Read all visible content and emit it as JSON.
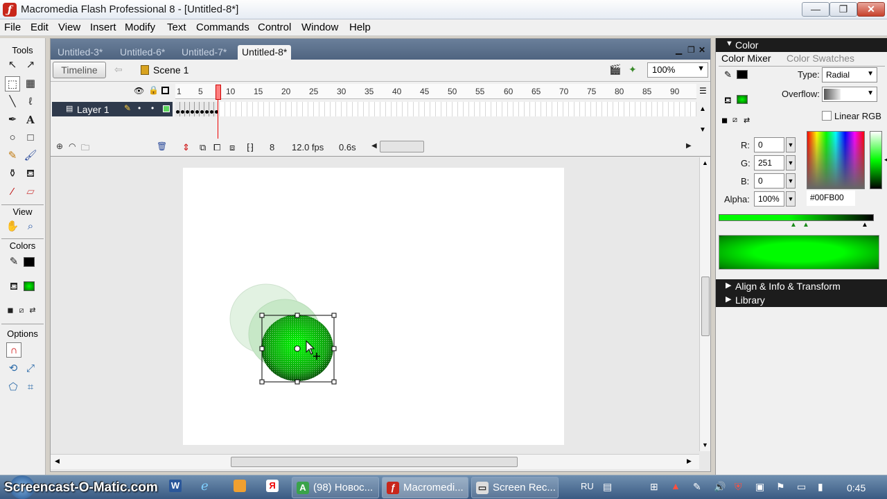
{
  "window": {
    "title": "Macromedia Flash Professional 8 - [Untitled-8*]",
    "app_icon": "flash-app-icon",
    "minimize": "—",
    "restore": "❐",
    "close": "✕"
  },
  "menu": [
    "File",
    "Edit",
    "View",
    "Insert",
    "Modify",
    "Text",
    "Commands",
    "Control",
    "Window",
    "Help"
  ],
  "tools": {
    "header": "Tools",
    "view_header": "View",
    "colors_header": "Colors",
    "options_header": "Options"
  },
  "document": {
    "tabs": [
      "Untitled-3*",
      "Untitled-6*",
      "Untitled-7*",
      "Untitled-8*"
    ],
    "active_tab": "Untitled-8*",
    "timeline_button": "Timeline",
    "scene_label": "Scene 1",
    "zoom": "100%"
  },
  "timeline": {
    "ruler": [
      "1",
      "5",
      "10",
      "15",
      "20",
      "25",
      "30",
      "35",
      "40",
      "45",
      "50",
      "55",
      "60",
      "65",
      "70",
      "75",
      "80",
      "85",
      "90"
    ],
    "layer_name": "Layer 1",
    "current_frame": "8",
    "fps": "12.0 fps",
    "elapsed": "0.6s"
  },
  "color_panel": {
    "title": "Color",
    "tab_mixer": "Color Mixer",
    "tab_swatches": "Color Swatches",
    "type_label": "Type:",
    "type_value": "Radial",
    "overflow_label": "Overflow:",
    "linear_rgb": "Linear RGB",
    "r_label": "R:",
    "r_value": "0",
    "g_label": "G:",
    "g_value": "251",
    "b_label": "B:",
    "b_value": "0",
    "alpha_label": "Alpha:",
    "alpha_value": "100%",
    "hex_value": "#00FB00",
    "fill_color": "#00FB00"
  },
  "collapsed_panels": [
    "Align & Info & Transform",
    "Library"
  ],
  "taskbar": {
    "watermark": "Screencast-O-Matic.com",
    "buttons": [
      "(98) Новос...",
      "Macromedi...",
      "Screen Rec..."
    ],
    "language": "RU",
    "clock": "0:45"
  }
}
